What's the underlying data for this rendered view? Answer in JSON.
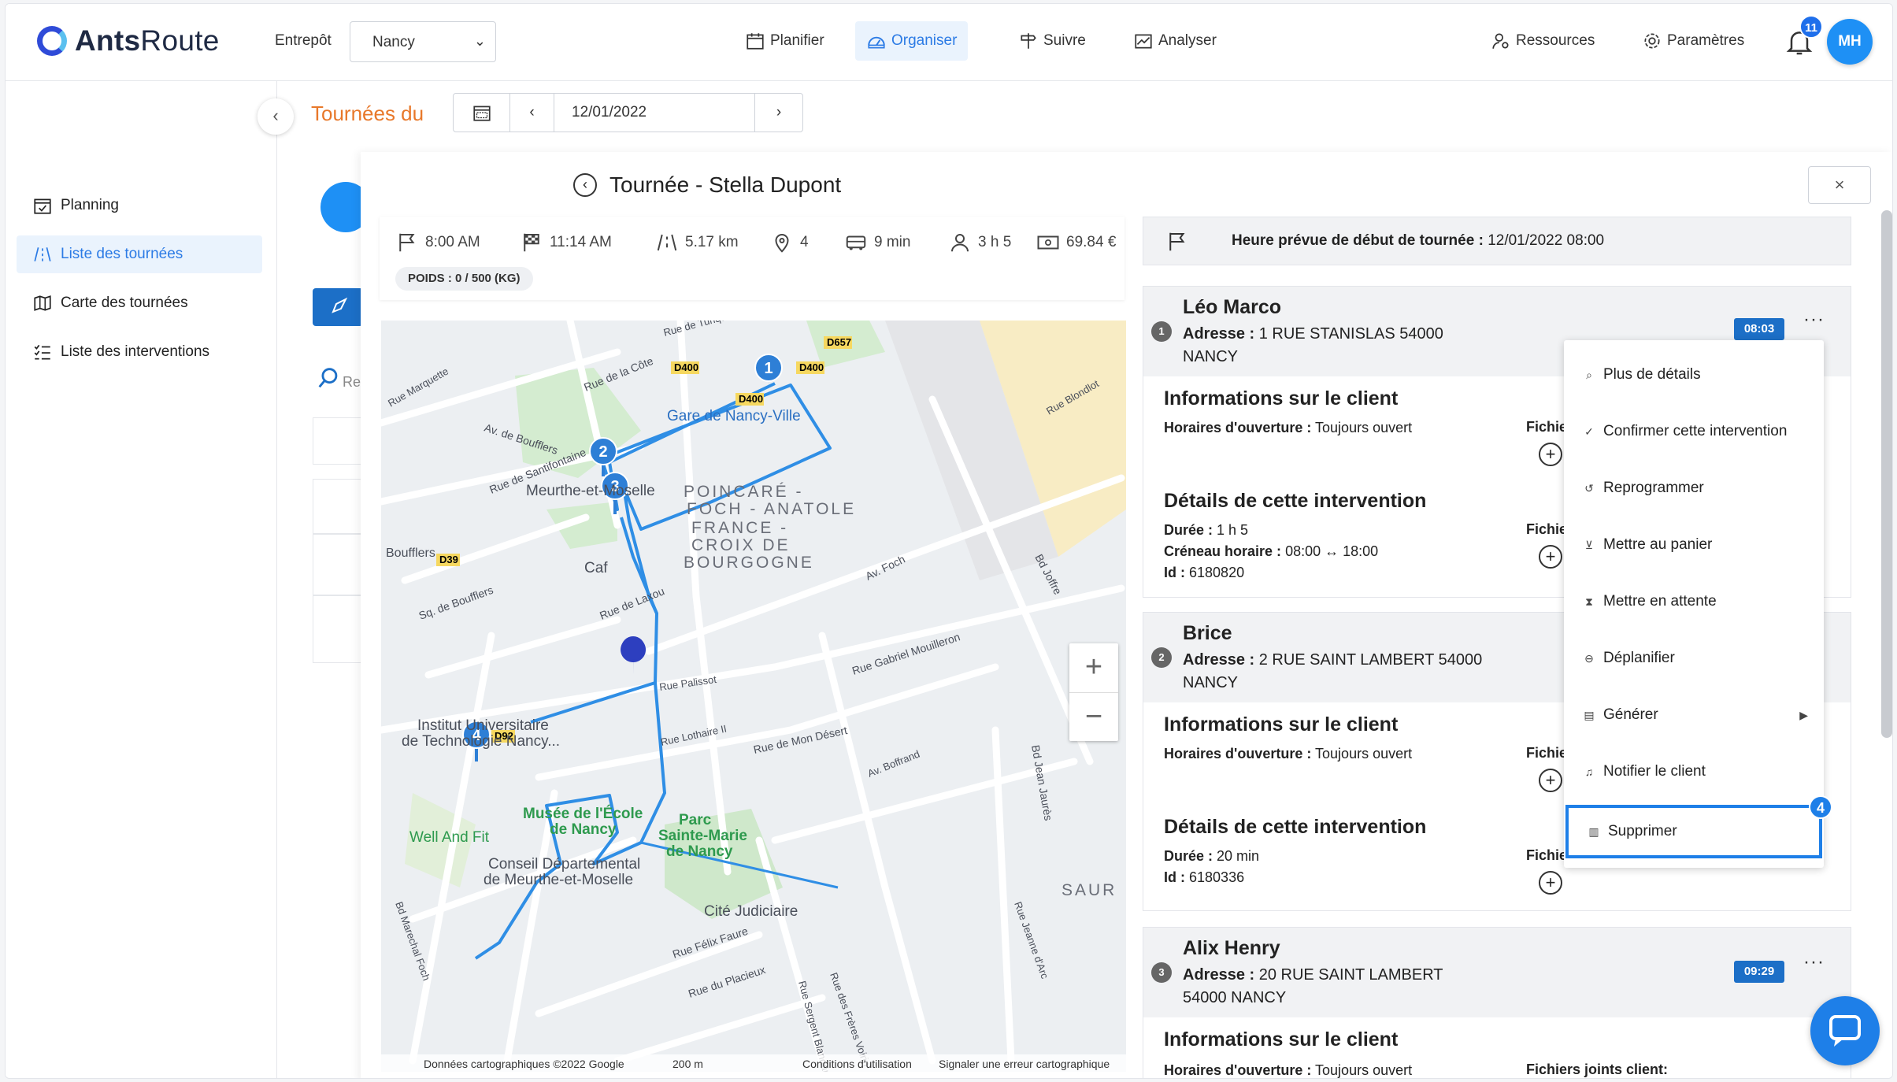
{
  "brand": {
    "name_bold": "Ants",
    "name_light": "Route"
  },
  "header": {
    "warehouse_label": "Entrepôt",
    "warehouse_value": "Nancy",
    "nav": [
      {
        "label": "Planifier",
        "icon": "calendar-icon"
      },
      {
        "label": "Organiser",
        "icon": "dashboard-icon",
        "active": true
      },
      {
        "label": "Suivre",
        "icon": "signpost-icon"
      },
      {
        "label": "Analyser",
        "icon": "chart-icon"
      }
    ],
    "resources_label": "Ressources",
    "settings_label": "Paramètres",
    "notification_count": "11",
    "avatar_initials": "MH",
    "accent_color": "#2c7be5"
  },
  "sidebar": {
    "items": [
      {
        "label": "Planning",
        "icon": "calendar-check-icon"
      },
      {
        "label": "Liste des tournées",
        "icon": "road-icon",
        "active": true
      },
      {
        "label": "Carte des tournées",
        "icon": "map-icon"
      },
      {
        "label": "Liste des interventions",
        "icon": "list-icon"
      }
    ]
  },
  "toolbar": {
    "title": "Tournées du",
    "date": "12/01/2022",
    "search_placeholder": "Re"
  },
  "panel": {
    "title": "Tournée - Stella Dupont",
    "close_label": "×",
    "stats": [
      {
        "icon": "flag-icon",
        "value": "8:00 AM"
      },
      {
        "icon": "checkered-flag-icon",
        "value": "11:14 AM"
      },
      {
        "icon": "road-icon",
        "value": "5.17 km"
      },
      {
        "icon": "pin-icon",
        "value": "4"
      },
      {
        "icon": "truck-icon",
        "value": "9 min"
      },
      {
        "icon": "person-icon",
        "value": "3 h 5"
      },
      {
        "icon": "money-icon",
        "value": "69.84 €"
      }
    ],
    "poids": "POIDS : 0 / 500 (KG)",
    "start_label": "Heure prévue de début de tournée :",
    "start_value": "12/01/2022 08:00"
  },
  "map": {
    "labels": [
      "Gare de Nancy-Ville",
      "Meurthe-et-Moselle",
      "POINCARÉ -",
      "FOCH - ANATOLE",
      "FRANCE -",
      "CROIX DE",
      "BOURGOGNE",
      "Institut Universitaire",
      "de Technologie Nancy...",
      "Musée de l'École",
      "de Nancy",
      "Parc",
      "Sainte-Marie",
      "de Nancy",
      "Well And Fit",
      "Conseil Départemental",
      "de Meurthe-et-Moselle",
      "Cité Judiciaire",
      "SAUR",
      "Rue de la Côte",
      "Av. de Boufflers",
      "Rue de Santifontaine",
      "Rue de Laxou",
      "Rue de Mon Désert",
      "Rue Gabriel Mouilleron",
      "Rue Félix Faure",
      "Rue du Placieux",
      "Bd Joffre",
      "Bd Jean Jaurès",
      "Av. Foch",
      "Rue Palissot",
      "Rue Lothaire II",
      "Av. Boffrand",
      "Sq. de Boufflers",
      "Boufflers",
      "Caf",
      "Rue de la Côte",
      "Rue de Turique",
      "D400",
      "D657",
      "D39",
      "D92",
      "Rue Blondlot",
      "Rue Jeanne d'Arc",
      "Bd Marechal Foch",
      "Rue Sergent Blandan",
      "Rue des Frères Voirin",
      "Rue Marquette"
    ],
    "markers": [
      "1",
      "2",
      "3",
      "4"
    ],
    "credit_data": "Données cartographiques ©2022 Google",
    "credit_scale": "200 m",
    "credit_terms": "Conditions d'utilisation",
    "credit_report": "Signaler une erreur cartographique",
    "route_color": "#2f8ee5"
  },
  "interventions": [
    {
      "num": "1",
      "name": "Léo Marco",
      "addr_label": "Adresse :",
      "addr_line1": "1 RUE STANISLAS 54000",
      "addr_line2": "NANCY",
      "time": "08:03",
      "client_title": "Informations sur le client",
      "hours_label": "Horaires d'ouverture :",
      "hours_value": "Toujours ouvert",
      "files_label": "Fichie",
      "details_title": "Détails de cette intervention",
      "duration_label": "Durée :",
      "duration_value": "1 h 5",
      "slot_label": "Créneau horaire :",
      "slot_value": "08:00 ↔ 18:00",
      "id_label": "Id :",
      "id_value": "6180820"
    },
    {
      "num": "2",
      "name": "Brice",
      "addr_label": "Adresse :",
      "addr_line1": "2 RUE SAINT LAMBERT 54000",
      "addr_line2": "NANCY",
      "client_title": "Informations sur le client",
      "hours_label": "Horaires d'ouverture :",
      "hours_value": "Toujours ouvert",
      "files_label": "Fichie",
      "details_title": "Détails de cette intervention",
      "duration_label": "Durée :",
      "duration_value": "20 min",
      "id_label": "Id :",
      "id_value": "6180336"
    },
    {
      "num": "3",
      "name": "Alix Henry",
      "addr_label": "Adresse :",
      "addr_line1": "20 RUE SAINT LAMBERT",
      "addr_line2": "54000 NANCY",
      "time": "09:29",
      "client_title": "Informations sur le client",
      "hours_label": "Horaires d'ouverture :",
      "hours_value": "Toujours ouvert",
      "files_label": "Fichiers joints client:"
    }
  ],
  "context_menu": {
    "items": [
      {
        "label": "Plus de détails",
        "icon": "magnifier-icon",
        "glyph": "⌕"
      },
      {
        "label": "Confirmer cette intervention",
        "icon": "pin-icon",
        "glyph": "✓"
      },
      {
        "label": "Reprogrammer",
        "icon": "history-icon",
        "glyph": "↺"
      },
      {
        "label": "Mettre au panier",
        "icon": "basket-icon",
        "glyph": "⊻"
      },
      {
        "label": "Mettre en attente",
        "icon": "hourglass-icon",
        "glyph": "⧗"
      },
      {
        "label": "Déplanifier",
        "icon": "minus-circle-icon",
        "glyph": "⊖"
      },
      {
        "label": "Générer",
        "icon": "document-icon",
        "glyph": "▤",
        "submenu": true
      },
      {
        "label": "Notifier le client",
        "icon": "bell-icon",
        "glyph": "♫"
      },
      {
        "label": "Supprimer",
        "icon": "trash-icon",
        "glyph": "▥",
        "highlighted": true
      }
    ],
    "step_badge": "4"
  }
}
